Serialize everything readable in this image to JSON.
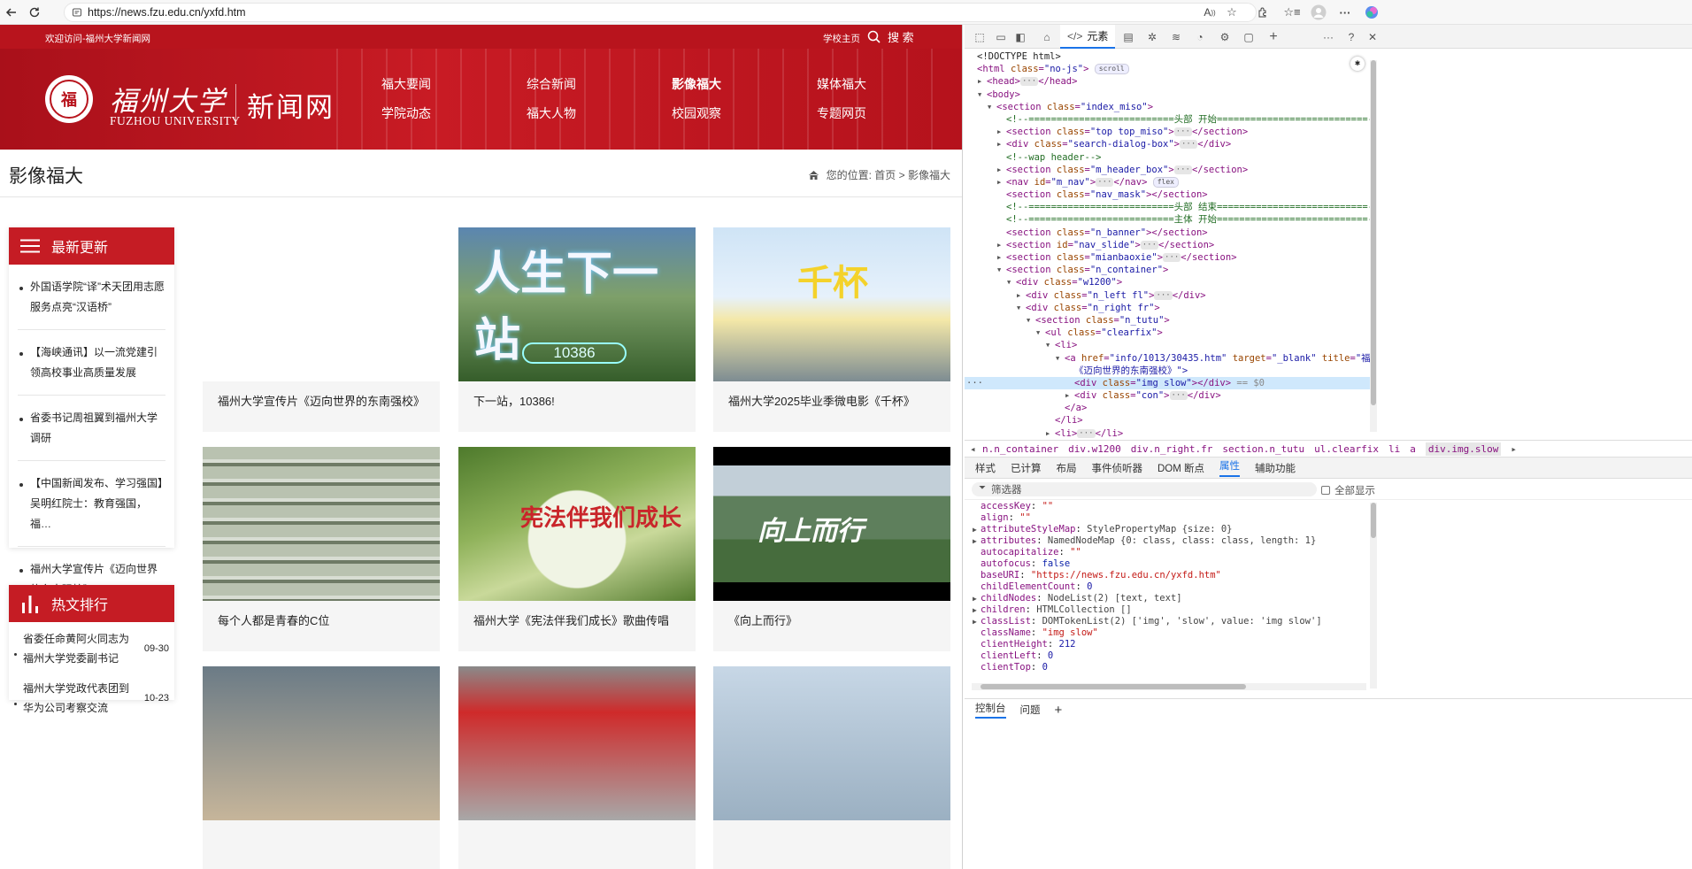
{
  "browser": {
    "url": "https://news.fzu.edu.cn/yxfd.htm",
    "reader_label": "A"
  },
  "site": {
    "welcome": "欢迎访问-福州大学新闻网",
    "home_link": "学校主页",
    "search_label": "搜 索",
    "logo": {
      "seal_char": "福",
      "cn_name": "福州大学",
      "en_name": "FUZHOU UNIVERSITY",
      "site_name": "新闻网"
    },
    "menu": [
      "福大要闻",
      "综合新闻",
      "影像福大",
      "媒体福大",
      "学院动态",
      "福大人物",
      "校园观察",
      "专题网页"
    ],
    "menu_active": "影像福大",
    "page_title": "影像福大",
    "breadcrumb": {
      "prefix": "您的位置:",
      "home": "首页",
      "sep": ">",
      "current": "影像福大"
    },
    "latest": {
      "title": "最新更新",
      "items": [
        "外国语学院“译”术天团用志愿服务点亮“汉语桥”",
        "【海峡通讯】以一流党建引领高校事业高质量发展",
        "省委书记周祖翼到福州大学调研",
        "【中国新闻发布、学习强国】吴明红院士：教育强国，福…",
        "福州大学宣传片《迈向世界的东南强校》"
      ]
    },
    "hot": {
      "title": "热文排行",
      "items": [
        {
          "title": "省委任命黄阿火同志为福州大学党委副书记",
          "date": "09-30"
        },
        {
          "title": "福州大学党政代表团到华为公司考察交流",
          "date": "10-23"
        }
      ]
    },
    "cards": [
      {
        "caption": "福州大学宣传片《迈向世界的东南强校》"
      },
      {
        "caption": "下一站，10386!",
        "overlay": "人生下一站",
        "badge": "10386"
      },
      {
        "caption": "福州大学2025毕业季微电影《千杯》",
        "overlay": "千杯"
      },
      {
        "caption": "每个人都是青春的C位"
      },
      {
        "caption": "福州大学《宪法伴我们成长》歌曲传唱",
        "overlay": "宪法伴我们成长"
      },
      {
        "caption": "《向上而行》",
        "overlay": "向上而行"
      },
      {
        "caption": ""
      },
      {
        "caption": ""
      },
      {
        "caption": ""
      }
    ]
  },
  "devtools": {
    "elements_tab": "元素",
    "dom_lines": [
      {
        "indent": 0,
        "html": "<!DOCTYPE html>"
      },
      {
        "indent": 0,
        "tag": "html",
        "attrs": [
          [
            "class",
            "no-js"
          ]
        ],
        "pill": "scroll"
      },
      {
        "indent": 1,
        "collapsed": true,
        "tag": "head",
        "close": "head"
      },
      {
        "indent": 1,
        "open": true,
        "tag": "body"
      },
      {
        "indent": 2,
        "open": true,
        "tag": "section",
        "attrs": [
          [
            "class",
            "index_miso"
          ]
        ]
      },
      {
        "indent": 3,
        "comment": "<!--==========================头部 开始===========================-->"
      },
      {
        "indent": 3,
        "collapsed": true,
        "tag": "section",
        "attrs": [
          [
            "class",
            "top top_miso"
          ]
        ],
        "close": "section"
      },
      {
        "indent": 3,
        "collapsed": true,
        "tag": "div",
        "attrs": [
          [
            "class",
            "search-dialog-box"
          ]
        ],
        "close": "div"
      },
      {
        "indent": 3,
        "comment": "<!--wap header-->"
      },
      {
        "indent": 3,
        "collapsed": true,
        "tag": "section",
        "attrs": [
          [
            "class",
            "m_header_box"
          ]
        ],
        "close": "section"
      },
      {
        "indent": 3,
        "collapsed": true,
        "tag": "nav",
        "attrs": [
          [
            "id",
            "m_nav"
          ]
        ],
        "close": "nav",
        "pill": "flex"
      },
      {
        "indent": 3,
        "tag": "section",
        "attrs": [
          [
            "class",
            "nav_mask"
          ]
        ],
        "close": "section",
        "empty": true
      },
      {
        "indent": 3,
        "comment": "<!--==========================头部 结束===========================-->"
      },
      {
        "indent": 3,
        "comment": "<!--==========================主体 开始===========================-->"
      },
      {
        "indent": 3,
        "tag": "section",
        "attrs": [
          [
            "class",
            "n_banner"
          ]
        ],
        "close": "section",
        "empty": true
      },
      {
        "indent": 3,
        "collapsed": true,
        "tag": "section",
        "attrs": [
          [
            "id",
            "nav_slide"
          ]
        ],
        "close": "section"
      },
      {
        "indent": 3,
        "collapsed": true,
        "tag": "section",
        "attrs": [
          [
            "class",
            "mianbaoxie"
          ]
        ],
        "close": "section"
      },
      {
        "indent": 3,
        "open": true,
        "tag": "section",
        "attrs": [
          [
            "class",
            "n_container"
          ]
        ]
      },
      {
        "indent": 4,
        "open": true,
        "tag": "div",
        "attrs": [
          [
            "class",
            "w1200"
          ]
        ]
      },
      {
        "indent": 5,
        "collapsed": true,
        "tag": "div",
        "attrs": [
          [
            "class",
            "n_left fl"
          ]
        ],
        "close": "div"
      },
      {
        "indent": 5,
        "open": true,
        "tag": "div",
        "attrs": [
          [
            "class",
            "n_right fr"
          ]
        ]
      },
      {
        "indent": 6,
        "open": true,
        "tag": "section",
        "attrs": [
          [
            "class",
            "n_tutu"
          ]
        ]
      },
      {
        "indent": 7,
        "open": true,
        "tag": "ul",
        "attrs": [
          [
            "class",
            "clearfix"
          ]
        ]
      },
      {
        "indent": 8,
        "open": true,
        "tag": "li"
      },
      {
        "indent": 9,
        "open": true,
        "tag": "a",
        "attrs": [
          [
            "href",
            "info/1013/30435.htm"
          ],
          [
            "target",
            "_blank"
          ],
          [
            "title",
            "福州大学宣传片"
          ]
        ]
      },
      {
        "indent": 10,
        "text": "《迈向世界的东南强校》\">"
      },
      {
        "indent": 10,
        "selected": true,
        "tag": "div",
        "attrs": [
          [
            "class",
            "img slow"
          ]
        ],
        "close": "div",
        "empty": true,
        "suffix": " == $0"
      },
      {
        "indent": 10,
        "collapsed": true,
        "tag": "div",
        "attrs": [
          [
            "class",
            "con"
          ]
        ],
        "close": "div"
      },
      {
        "indent": 9,
        "closing": "a"
      },
      {
        "indent": 8,
        "closing": "li"
      },
      {
        "indent": 8,
        "collapsed": true,
        "tag": "li",
        "close": "li"
      }
    ],
    "crumbs": [
      "n.n_container",
      "div.w1200",
      "div.n_right.fr",
      "section.n_tutu",
      "ul.clearfix",
      "li",
      "a",
      "div.img.slow"
    ],
    "panel_tabs": [
      "样式",
      "已计算",
      "布局",
      "事件侦听器",
      "DOM 断点",
      "属性",
      "辅助功能"
    ],
    "panel_active": "属性",
    "filter_placeholder": "筛选器",
    "show_all": "全部显示",
    "props": [
      {
        "k": "accessKey",
        "v": "\"\"",
        "type": "s"
      },
      {
        "k": "align",
        "v": "\"\"",
        "type": "s"
      },
      {
        "k": "attributeStyleMap",
        "v": "StylePropertyMap {size: 0}",
        "type": "o",
        "exp": true
      },
      {
        "k": "attributes",
        "v": "NamedNodeMap {0: class, class: class, length: 1}",
        "type": "o",
        "exp": true
      },
      {
        "k": "autocapitalize",
        "v": "\"\"",
        "type": "s"
      },
      {
        "k": "autofocus",
        "v": "false",
        "type": "b"
      },
      {
        "k": "baseURI",
        "v": "\"https://news.fzu.edu.cn/yxfd.htm\"",
        "type": "s"
      },
      {
        "k": "childElementCount",
        "v": "0",
        "type": "n"
      },
      {
        "k": "childNodes",
        "v": "NodeList(2) [text, text]",
        "type": "o",
        "exp": true
      },
      {
        "k": "children",
        "v": "HTMLCollection []",
        "type": "o",
        "exp": true
      },
      {
        "k": "classList",
        "v": "DOMTokenList(2) ['img', 'slow', value: 'img slow']",
        "type": "o",
        "exp": true
      },
      {
        "k": "className",
        "v": "\"img slow\"",
        "type": "s"
      },
      {
        "k": "clientHeight",
        "v": "212",
        "type": "n"
      },
      {
        "k": "clientLeft",
        "v": "0",
        "type": "n"
      },
      {
        "k": "clientTop",
        "v": "0",
        "type": "n"
      }
    ],
    "drawer_tabs": [
      "控制台",
      "问题"
    ]
  }
}
